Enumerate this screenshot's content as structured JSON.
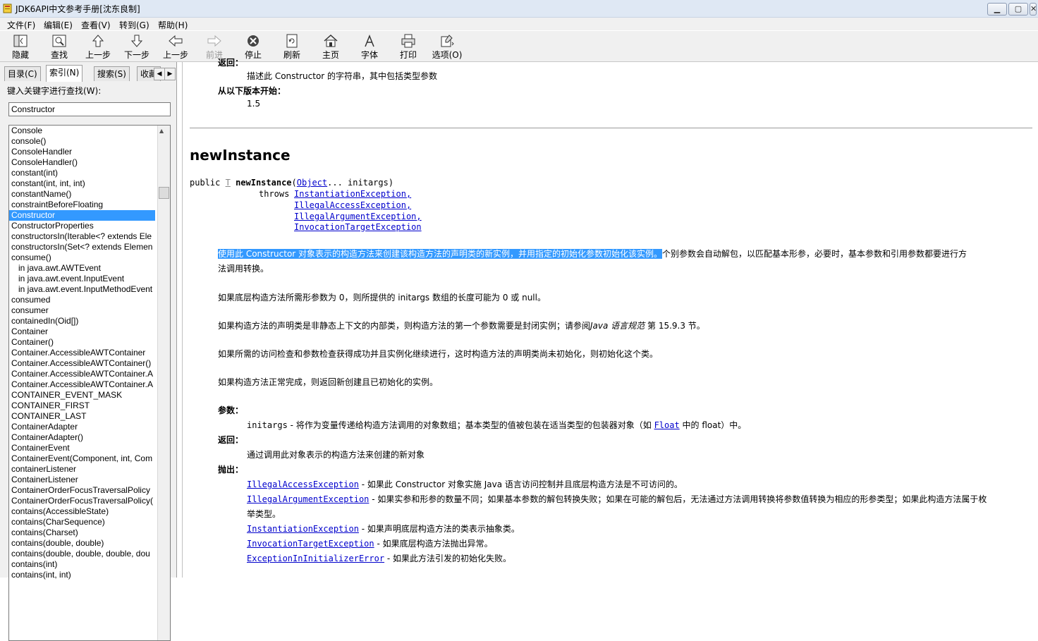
{
  "window": {
    "title": "JDK6API中文参考手册[沈东良制]"
  },
  "menu": [
    "文件(F)",
    "编辑(E)",
    "查看(V)",
    "转到(G)",
    "帮助(H)"
  ],
  "toolbar": [
    "隐藏",
    "查找",
    "上一步",
    "下一步",
    "上一步",
    "前进",
    "停止",
    "刷新",
    "主页",
    "字体",
    "打印",
    "选项(O)"
  ],
  "tabs": [
    "目录(C)",
    "索引(N)",
    "搜索(S)",
    "收藏"
  ],
  "search": {
    "label": "键入关键字进行查找(W):",
    "value": "Constructor"
  },
  "keywords": [
    "Console",
    "console()",
    "ConsoleHandler",
    "ConsoleHandler()",
    "constant(int)",
    "constant(int, int, int)",
    "constantName()",
    "constraintBeforeFloating",
    "Constructor",
    "ConstructorProperties",
    "constructorsIn(Iterable<? extends Ele",
    "constructorsIn(Set<? extends Elemen",
    "consume()",
    "in java.awt.AWTEvent",
    "in java.awt.event.InputEvent",
    "in java.awt.event.InputMethodEvent",
    "consumed",
    "consumer",
    "containedIn(Oid[])",
    "Container",
    "Container()",
    "Container.AccessibleAWTContainer",
    "Container.AccessibleAWTContainer()",
    "Container.AccessibleAWTContainer.A",
    "Container.AccessibleAWTContainer.A",
    "CONTAINER_EVENT_MASK",
    "CONTAINER_FIRST",
    "CONTAINER_LAST",
    "ContainerAdapter",
    "ContainerAdapter()",
    "ContainerEvent",
    "ContainerEvent(Component, int, Com",
    "containerListener",
    "ContainerListener",
    "ContainerOrderFocusTraversalPolicy",
    "ContainerOrderFocusTraversalPolicy(",
    "contains(AccessibleState)",
    "contains(CharSequence)",
    "contains(Charset)",
    "contains(double, double)",
    "contains(double, double, double, dou",
    "contains(int)",
    "contains(int, int)"
  ],
  "selected_keyword": "Constructor",
  "content": {
    "returns_label_top": "返回：",
    "returns_desc_top": "描述此 Constructor 的字符串，其中包括类型参数",
    "since_label": "从以下版本开始：",
    "since_value": "1.5",
    "method_title": "newInstance",
    "sig_public": "public",
    "sig_T": "T",
    "sig_name": "newInstance",
    "sig_paren_open": "(",
    "sig_object": "Object",
    "sig_rest": "... initargs)",
    "sig_throws": "throws",
    "exceptions_sig": [
      "InstantiationException,",
      "IllegalAccessException,",
      "IllegalArgumentException,",
      "InvocationTargetException"
    ],
    "p1_highlight": "使用此 Constructor 对象表示的构造方法来创建该构造方法的声明类的新实例，并用指定的初始化参数初始化该实例。",
    "p1_rest": "个别参数会自动解包，以匹配基本形参，必要时，基本参数和引用参数都要进行方",
    "p1_line2": "法调用转换。",
    "p2": "如果底层构造方法所需形参数为 0，则所提供的 initargs 数组的长度可能为 0 或 null。",
    "p3_a": "如果构造方法的声明类是非静态上下文的内部类，则构造方法的第一个参数需要是封闭实例；请参阅",
    "p3_italic": "Java 语言规范",
    "p3_b": " 第 15.9.3 节。",
    "p4": "如果所需的访问检查和参数检查获得成功并且实例化继续进行，这时构造方法的声明类尚未初始化，则初始化这个类。",
    "p5": "如果构造方法正常完成，则返回新创建且已初始化的实例。",
    "params_label": "参数：",
    "param_name": "initargs",
    "param_desc_a": " - 将作为变量传递给构造方法调用的对象数组；基本类型的值被包装在适当类型的包装器对象（如 ",
    "param_float": "Float",
    "param_desc_b": " 中的 float）中。",
    "returns_label": "返回：",
    "returns_desc": "通过调用此对象表示的构造方法来创建的新对象",
    "throws_label": "抛出：",
    "throws": [
      {
        "name": "IllegalAccessException",
        "desc": " - 如果此 Constructor 对象实施 Java 语言访问控制并且底层构造方法是不可访问的。"
      },
      {
        "name": "IllegalArgumentException",
        "desc": " - 如果实参和形参的数量不同；如果基本参数的解包转换失败；如果在可能的解包后，无法通过方法调用转换将参数值转换为相应的形参类型；如果此构造方法属于枚",
        "desc2": "举类型。"
      },
      {
        "name": "InstantiationException",
        "desc": " - 如果声明底层构造方法的类表示抽象类。"
      },
      {
        "name": "InvocationTargetException",
        "desc": " - 如果底层构造方法抛出异常。"
      },
      {
        "name": "ExceptionInInitializerError",
        "desc": " - 如果此方法引发的初始化失败。"
      }
    ]
  },
  "colors": {
    "selection": "#3399ff",
    "link": "#0000cc",
    "titlebar": "#dfe8f4",
    "chrome": "#f0f0f0"
  }
}
